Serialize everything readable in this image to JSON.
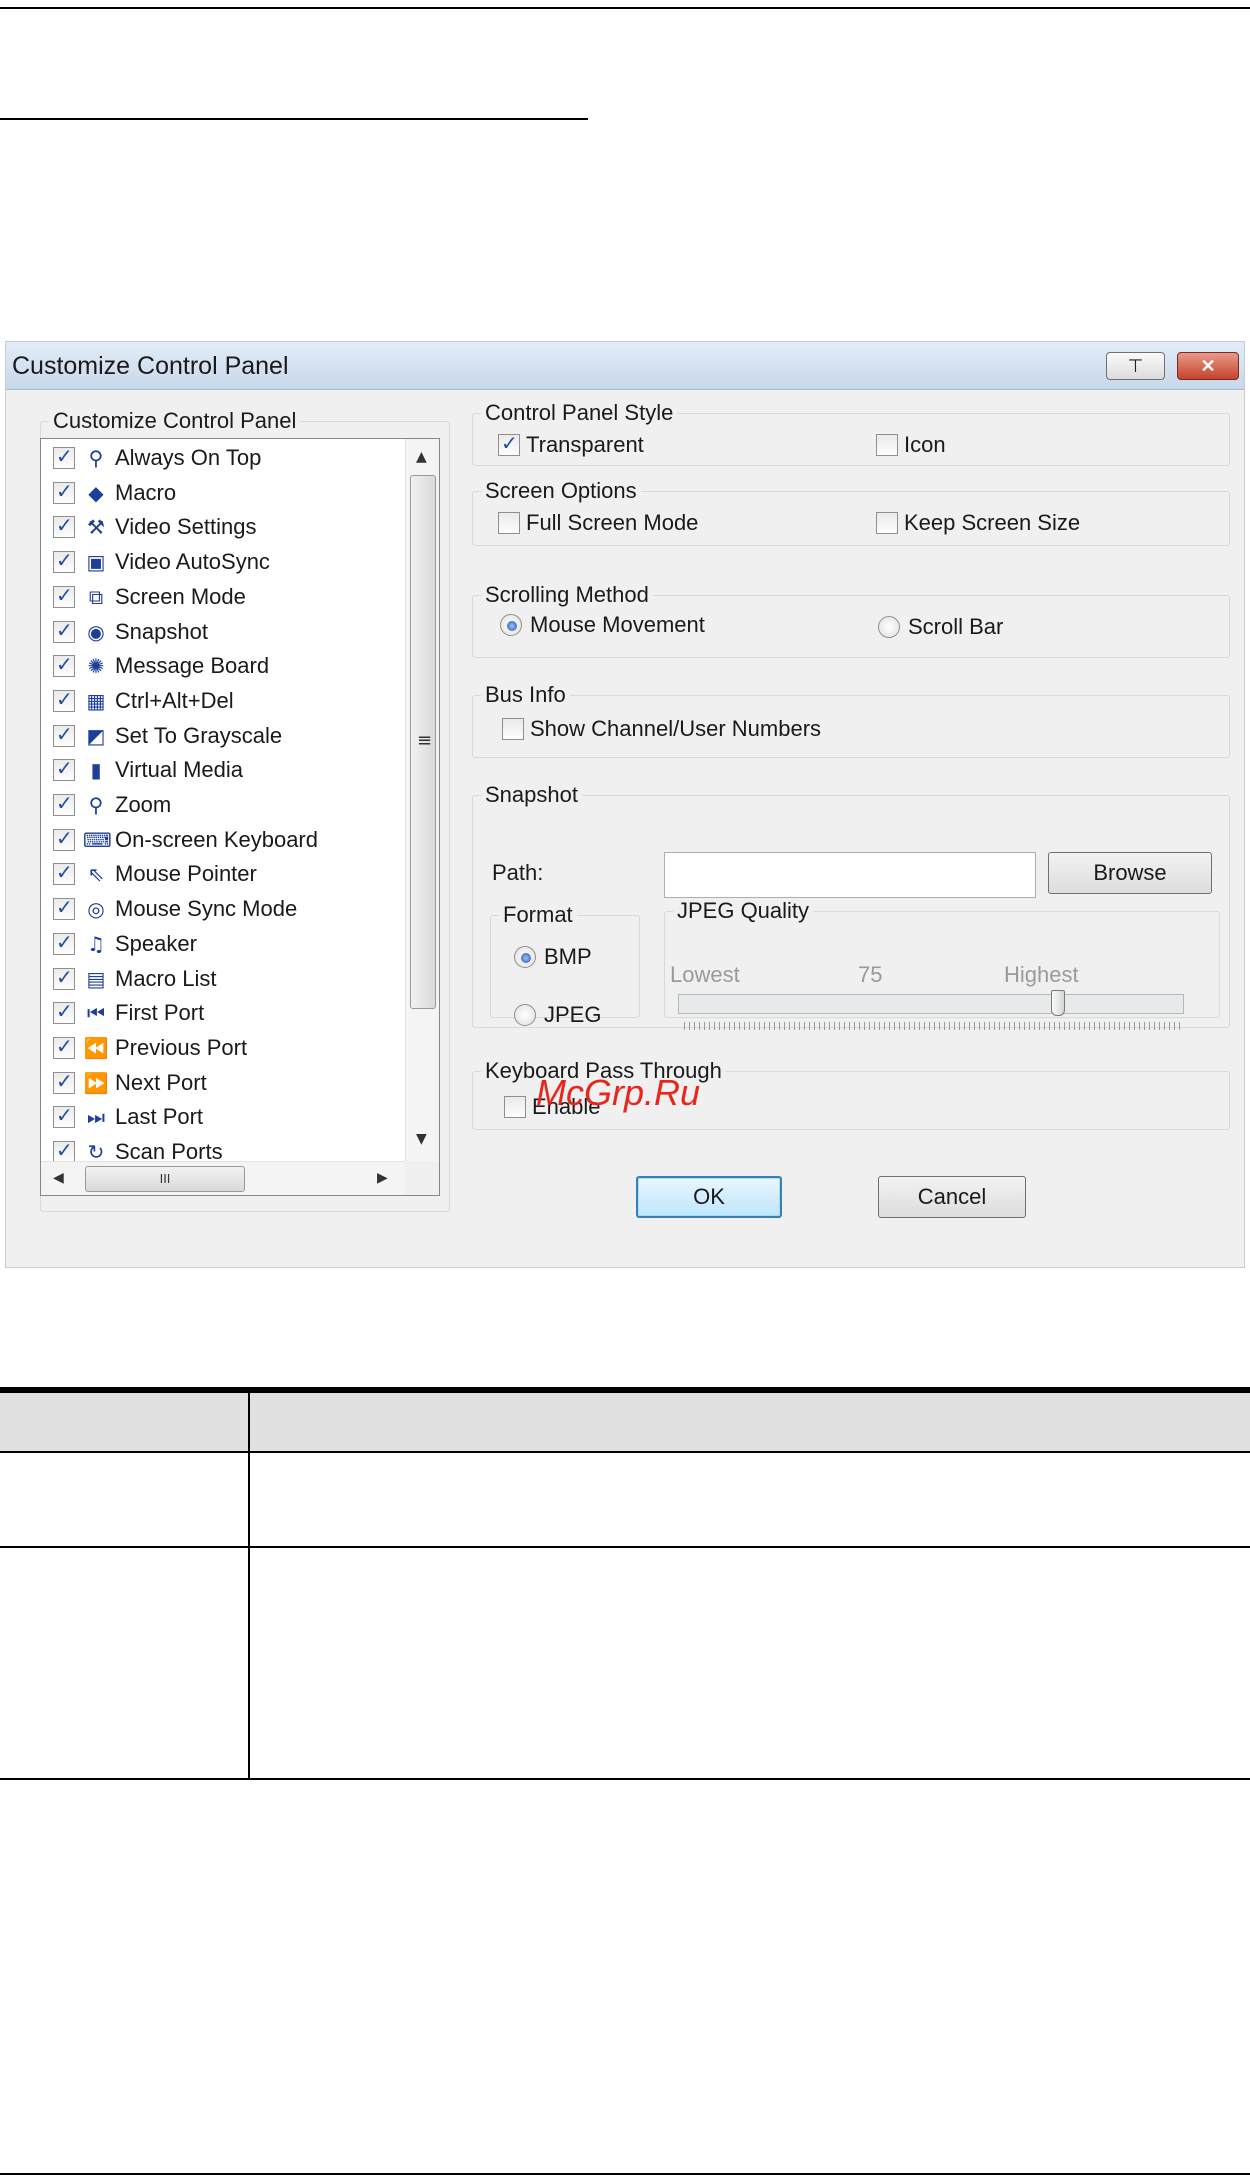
{
  "dialog": {
    "title": "Customize Control Panel",
    "pin_glyph": "⊤",
    "close_glyph": "✕",
    "list_group_label": "Customize Control Panel",
    "items": [
      {
        "label": "Always On Top",
        "icon": "pin-icon",
        "glyph": "⚲",
        "checked": true
      },
      {
        "label": "Macro",
        "icon": "macro-icon",
        "glyph": "◆",
        "checked": true
      },
      {
        "label": "Video Settings",
        "icon": "hammer-icon",
        "glyph": "⚒",
        "checked": true
      },
      {
        "label": "Video AutoSync",
        "icon": "monitor-sync-icon",
        "glyph": "▣",
        "checked": true
      },
      {
        "label": "Screen Mode",
        "icon": "window-mode-icon",
        "glyph": "⧉",
        "checked": true
      },
      {
        "label": "Snapshot",
        "icon": "camera-icon",
        "glyph": "◉",
        "checked": true
      },
      {
        "label": "Message Board",
        "icon": "message-board-icon",
        "glyph": "✺",
        "checked": true
      },
      {
        "label": "Ctrl+Alt+Del",
        "icon": "ctrl-alt-del-icon",
        "glyph": "▦",
        "checked": true
      },
      {
        "label": "Set To Grayscale",
        "icon": "grayscale-icon",
        "glyph": "◩",
        "checked": true
      },
      {
        "label": "Virtual Media",
        "icon": "usb-drive-icon",
        "glyph": "▮",
        "checked": true
      },
      {
        "label": "Zoom",
        "icon": "magnifier-icon",
        "glyph": "⚲",
        "checked": true
      },
      {
        "label": "On-screen Keyboard",
        "icon": "keyboard-icon",
        "glyph": "⌨",
        "checked": true
      },
      {
        "label": "Mouse Pointer",
        "icon": "cursor-icon",
        "glyph": "⇖",
        "checked": true
      },
      {
        "label": "Mouse Sync Mode",
        "icon": "mouse-icon",
        "glyph": "◎",
        "checked": true
      },
      {
        "label": "Speaker",
        "icon": "speaker-icon",
        "glyph": "♫",
        "checked": true
      },
      {
        "label": "Macro List",
        "icon": "macro-list-icon",
        "glyph": "▤",
        "checked": true
      },
      {
        "label": "First Port",
        "icon": "first-port-icon",
        "glyph": "⏮",
        "checked": true
      },
      {
        "label": "Previous Port",
        "icon": "previous-port-icon",
        "glyph": "⏪",
        "checked": true
      },
      {
        "label": "Next Port",
        "icon": "next-port-icon",
        "glyph": "⏩",
        "checked": true
      },
      {
        "label": "Last Port",
        "icon": "last-port-icon",
        "glyph": "⏭",
        "checked": true
      },
      {
        "label": "Scan Ports",
        "icon": "scan-ports-icon",
        "glyph": "↻",
        "checked": true
      }
    ],
    "scroll": {
      "up": "▲",
      "down": "▼",
      "left": "◀",
      "right": "▶",
      "thumb_grip": "≡",
      "h_thumb_grip": "III"
    },
    "control_panel_style": {
      "label": "Control Panel Style",
      "transparent": {
        "label": "Transparent",
        "checked": true
      },
      "icon": {
        "label": "Icon",
        "checked": false
      }
    },
    "screen_options": {
      "label": "Screen Options",
      "full_screen": {
        "label": "Full Screen Mode",
        "checked": false
      },
      "keep_size": {
        "label": "Keep Screen Size",
        "checked": false
      }
    },
    "scrolling_method": {
      "label": "Scrolling Method",
      "mouse_movement": {
        "label": "Mouse Movement",
        "selected": true
      },
      "scroll_bar": {
        "label": "Scroll Bar",
        "selected": false
      }
    },
    "bus_info": {
      "label": "Bus Info",
      "show_numbers": {
        "label": "Show Channel/User Numbers",
        "checked": false
      }
    },
    "snapshot": {
      "label": "Snapshot",
      "path_label": "Path:",
      "path_value": "",
      "browse_label": "Browse",
      "format_label": "Format",
      "bmp": {
        "label": "BMP",
        "selected": true
      },
      "jpeg": {
        "label": "JPEG",
        "selected": false
      },
      "quality_label": "JPEG Quality",
      "lowest_label": "Lowest",
      "quality_value": "75",
      "highest_label": "Highest",
      "quality_fraction": 0.75
    },
    "keyboard_pass_through": {
      "label": "Keyboard Pass Through",
      "enable": {
        "label": "Enable",
        "checked": false
      }
    },
    "ok_label": "OK",
    "cancel_label": "Cancel",
    "watermark": "McGrp.Ru"
  },
  "colors": {
    "titlebar_top": "#e3edf8",
    "titlebar_bottom": "#c7d7ea",
    "dialog_bg": "#f0f0f0",
    "table_header_bg": "#e1e1e1",
    "watermark": "#e8261c"
  }
}
